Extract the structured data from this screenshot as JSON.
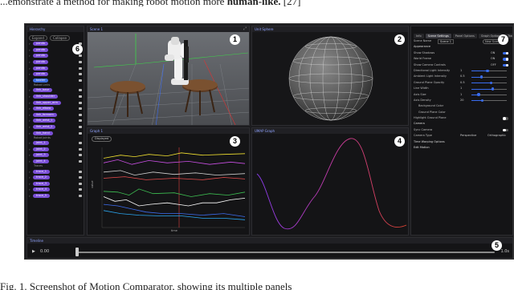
{
  "caption_top": {
    "text": "...emonstrate a method for making robot motion more ",
    "bold": "human-like.",
    "cite": " [27]"
  },
  "caption_bottom": {
    "text": "Fig. 1.    Screenshot of Motion Comparator, showing its multiple panels"
  },
  "markers": [
    "1",
    "2",
    "3",
    "4",
    "5",
    "6",
    "7"
  ],
  "hierarchy": {
    "header": "Hierarchy",
    "controls": [
      "Expand",
      "Collapse"
    ],
    "top_chips": [
      "panda",
      "panda",
      "panda",
      "panda",
      "panda",
      "panda",
      "baxter"
    ],
    "section_robot_links": "Robot Links",
    "robot_links": [
      "link_base",
      "link_shoulder",
      "link_upper_arm",
      "link_elbow",
      "link_forearm",
      "link_wrist_1",
      "link_wrist_2",
      "link_hand"
    ],
    "section_joints": "Robot Joints",
    "joints": [
      "joint_1",
      "joint_2",
      "joint_3",
      "joint_4"
    ],
    "section_traces": "Traces",
    "traces": [
      "trace_1",
      "trace_2",
      "trace_3",
      "trace_4",
      "trace_5"
    ]
  },
  "scene": {
    "header": "Scene 1",
    "icon": "expand-icon"
  },
  "sphere": {
    "header": "Unit Sphere"
  },
  "graph": {
    "header": "Graph 1",
    "toolbar": "Displayed",
    "ylabel": "value",
    "xlabel": "time"
  },
  "umap": {
    "header": "UMAP Graph"
  },
  "timeline": {
    "header": "Timeline",
    "play": "▶",
    "time": "0.00",
    "end": "1.0s"
  },
  "settings": {
    "tabs": [
      "Info",
      "Scene Settings",
      "Panel Options",
      "Graph Options",
      "Trace"
    ],
    "name_label": "Scene Name",
    "name_value": "Scene 1",
    "new_scene": "New Scene",
    "rows": [
      {
        "label": "Appearance",
        "type": "section"
      },
      {
        "label": "Show Shadows",
        "val": "ON",
        "toggle": "on"
      },
      {
        "label": "World Frame",
        "val": "ON",
        "toggle": "on"
      },
      {
        "label": "Show Camera Controls",
        "val": "OFF",
        "toggle": "on"
      },
      {
        "label": "Directional Light Intensity",
        "val": "1",
        "slider": 0.45
      },
      {
        "label": "Ambient Light Intensity",
        "val": "0.5",
        "slider": 0.28
      },
      {
        "label": "Ground Plane Opacity",
        "val": "0.5",
        "slider": 0.55
      },
      {
        "label": "Line Width",
        "val": "1",
        "slider": 0.6
      },
      {
        "label": "Axis Size",
        "val": "1",
        "slider": 0.2
      },
      {
        "label": "Axis Density",
        "val": "20",
        "slider": 0.3
      },
      {
        "label": "Background Color",
        "type": "sub"
      },
      {
        "label": "Ground Plane Color",
        "type": "sub"
      },
      {
        "label": "Highlight Ground Plane",
        "toggle": "off"
      },
      {
        "label": "Camera",
        "type": "section"
      },
      {
        "label": "Sync Camera",
        "toggle": "off"
      },
      {
        "label": "Camera Type",
        "val": "Perspective",
        "val2": "Orthographic"
      },
      {
        "label": "Time Warping Options",
        "type": "section"
      },
      {
        "label": "Edit Motion",
        "type": "section"
      }
    ]
  },
  "graph_lines": [
    {
      "color": "#f2e130",
      "points": [
        [
          0,
          0.12
        ],
        [
          0.12,
          0.08
        ],
        [
          0.22,
          0.1
        ],
        [
          0.32,
          0.07
        ],
        [
          0.45,
          0.09
        ],
        [
          0.55,
          0.05
        ],
        [
          0.7,
          0.08
        ],
        [
          0.85,
          0.07
        ],
        [
          1,
          0.06
        ]
      ]
    },
    {
      "color": "#c94fe3",
      "points": [
        [
          0,
          0.18
        ],
        [
          0.1,
          0.14
        ],
        [
          0.2,
          0.2
        ],
        [
          0.32,
          0.15
        ],
        [
          0.45,
          0.18
        ],
        [
          0.6,
          0.16
        ],
        [
          0.75,
          0.2
        ],
        [
          0.9,
          0.17
        ],
        [
          1,
          0.19
        ]
      ]
    },
    {
      "color": "#cfcfcf",
      "points": [
        [
          0,
          0.3
        ],
        [
          0.12,
          0.28
        ],
        [
          0.22,
          0.34
        ],
        [
          0.35,
          0.3
        ],
        [
          0.5,
          0.33
        ],
        [
          0.65,
          0.31
        ],
        [
          0.8,
          0.34
        ],
        [
          1,
          0.32
        ]
      ]
    },
    {
      "color": "#e84c4c",
      "points": [
        [
          0,
          0.38
        ],
        [
          0.15,
          0.36
        ],
        [
          0.3,
          0.4
        ],
        [
          0.5,
          0.38
        ],
        [
          0.7,
          0.4
        ],
        [
          0.85,
          0.37
        ],
        [
          1,
          0.39
        ]
      ]
    },
    {
      "color": "#3dbf52",
      "points": [
        [
          0,
          0.55
        ],
        [
          0.1,
          0.56
        ],
        [
          0.18,
          0.6
        ],
        [
          0.25,
          0.52
        ],
        [
          0.35,
          0.58
        ],
        [
          0.5,
          0.57
        ],
        [
          0.62,
          0.62
        ],
        [
          0.75,
          0.58
        ],
        [
          0.88,
          0.6
        ],
        [
          1,
          0.56
        ]
      ]
    },
    {
      "color": "#ffffff",
      "points": [
        [
          0,
          0.62
        ],
        [
          0.08,
          0.68
        ],
        [
          0.16,
          0.66
        ],
        [
          0.25,
          0.74
        ],
        [
          0.33,
          0.72
        ],
        [
          0.45,
          0.7
        ],
        [
          0.6,
          0.74
        ],
        [
          0.7,
          0.7
        ],
        [
          0.8,
          0.7
        ],
        [
          0.9,
          0.66
        ],
        [
          1,
          0.64
        ]
      ]
    },
    {
      "color": "#3d6df0",
      "points": [
        [
          0,
          0.72
        ],
        [
          0.1,
          0.74
        ],
        [
          0.2,
          0.78
        ],
        [
          0.3,
          0.82
        ],
        [
          0.42,
          0.84
        ],
        [
          0.55,
          0.84
        ],
        [
          0.7,
          0.86
        ],
        [
          0.85,
          0.84
        ],
        [
          1,
          0.88
        ]
      ]
    },
    {
      "color": "#2aa6f0",
      "points": [
        [
          0,
          0.8
        ],
        [
          0.12,
          0.84
        ],
        [
          0.25,
          0.86
        ],
        [
          0.4,
          0.87
        ],
        [
          0.55,
          0.87
        ],
        [
          0.7,
          0.9
        ],
        [
          0.85,
          0.9
        ],
        [
          1,
          0.92
        ]
      ]
    }
  ]
}
